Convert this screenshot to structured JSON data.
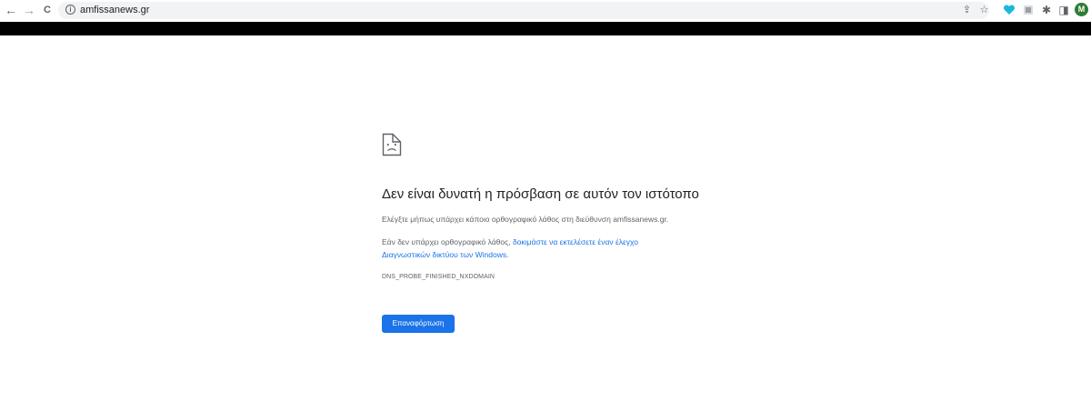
{
  "browser": {
    "back_icon": "←",
    "forward_icon": "→",
    "reload_icon": "C",
    "info_icon": "i",
    "url": "amfissanews.gr",
    "share_icon": "⇪",
    "star_icon": "☆",
    "puzzle_icon": "✱",
    "sidepanel_icon": "◨",
    "avatar_letter": "M",
    "colors": {
      "avatar": "#2e7d32",
      "extension_heart": "#1ab8d8"
    }
  },
  "error_page": {
    "title": "Δεν είναι δυνατή η πρόσβαση σε αυτόν τον ιστότοπο",
    "check_text": "Ελέγξτε μήπως υπάρχει κάποιο ορθογραφικό λάθος στη διεύθυνση amfissanews.gr.",
    "suggestion_prefix": "Εάν δεν υπάρχει ορθογραφικό λάθος,",
    "suggestion_link_line1": "δοκιμάστε να εκτελέσετε έναν έλεγχο",
    "suggestion_link_line2": "Διαγνωστικών δικτύου των Windows",
    "suggestion_suffix": ".",
    "error_code": "DNS_PROBE_FINISHED_NXDOMAIN",
    "reload_button": "Επαναφόρτωση",
    "colors": {
      "link": "#1a73e8",
      "button": "#1a73e8"
    }
  }
}
